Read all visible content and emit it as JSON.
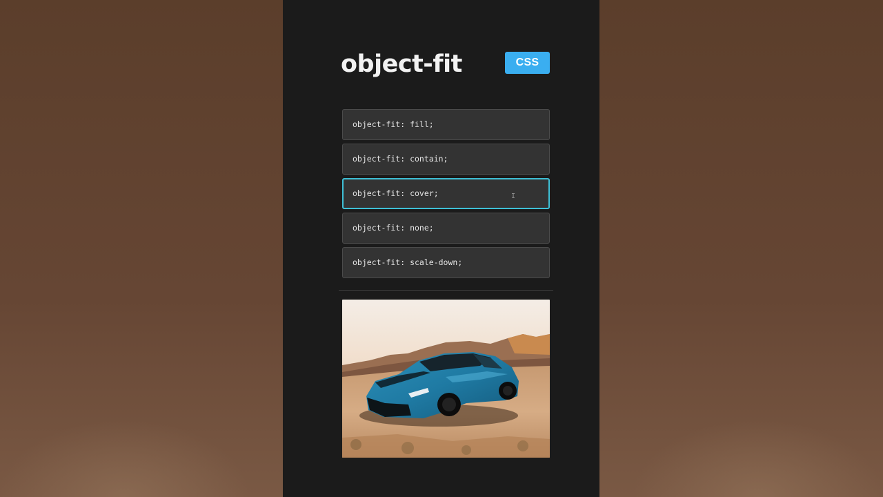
{
  "header": {
    "title": "object-fit",
    "badge": "CSS"
  },
  "options": [
    {
      "label": "object-fit: fill;",
      "selected": false
    },
    {
      "label": "object-fit: contain;",
      "selected": false
    },
    {
      "label": "object-fit: cover;",
      "selected": true
    },
    {
      "label": "object-fit: none;",
      "selected": false
    },
    {
      "label": "object-fit: scale-down;",
      "selected": false
    }
  ],
  "cursor": {
    "glyph": "I"
  },
  "preview": {
    "subject": "car-image"
  },
  "colors": {
    "accent": "#3aaef0",
    "selected_border": "#3ec0d6",
    "panel": "#1b1b1b",
    "option_bg": "#333333"
  }
}
